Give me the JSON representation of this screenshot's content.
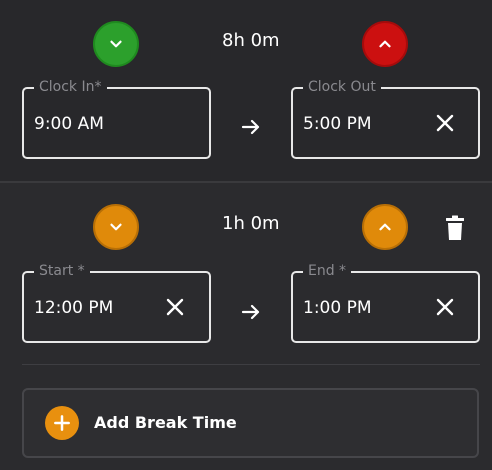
{
  "shift": {
    "duration": "8h 0m",
    "clock_in": {
      "label": "Clock In*",
      "value": "9:00 AM"
    },
    "clock_out": {
      "label": "Clock Out",
      "value": "5:00 PM"
    },
    "colors": {
      "down_button": "#2ca02c",
      "up_button": "#cc1010"
    }
  },
  "break": {
    "duration": "1h 0m",
    "start": {
      "label": "Start *",
      "value": "12:00 PM"
    },
    "end": {
      "label": "End *",
      "value": "1:00 PM"
    },
    "colors": {
      "buttons": "#e08a0a"
    }
  },
  "add_break": {
    "label": "Add Break Time",
    "color": "#e8900f"
  },
  "icons": {
    "down": "chevron-down-icon",
    "up": "chevron-up-icon",
    "clear": "close-icon",
    "arrow": "arrow-right-icon",
    "delete": "trash-icon",
    "add": "plus-icon"
  }
}
